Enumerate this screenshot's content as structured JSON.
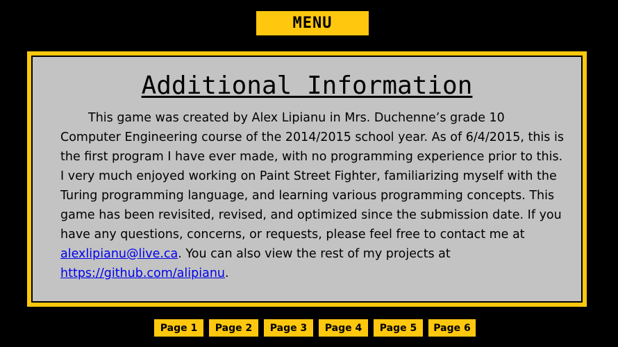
{
  "menu": {
    "label": "MENU"
  },
  "info": {
    "title": "Additional Information",
    "paragraph_part1": "This game was created by Alex Lipianu in Mrs. Duchenne’s grade 10 Computer Engineering course of the 2014/2015 school year. As of 6/4/2015, this is the first program I have ever made, with no programming experience prior to this. I very much enjoyed working on Paint Street Fighter, familiarizing myself with the Turing programming language, and learning various programming concepts. This game has been revisited, revised, and optimized since the submission date. If you have any questions, concerns, or requests, please feel free to contact me at ",
    "email_link": "alexlipianu@live.ca",
    "paragraph_part2": ". You can also view the rest of my projects at ",
    "github_link": "https://github.com/alipianu",
    "paragraph_part3": "."
  },
  "pages": [
    {
      "label": "Page 1"
    },
    {
      "label": "Page 2"
    },
    {
      "label": "Page 3"
    },
    {
      "label": "Page 4"
    },
    {
      "label": "Page 5"
    },
    {
      "label": "Page 6"
    }
  ],
  "colors": {
    "background": "#000000",
    "accent_yellow": "#FFC80F",
    "panel_gray": "#C3C3C3",
    "link_blue": "#0000EE"
  }
}
